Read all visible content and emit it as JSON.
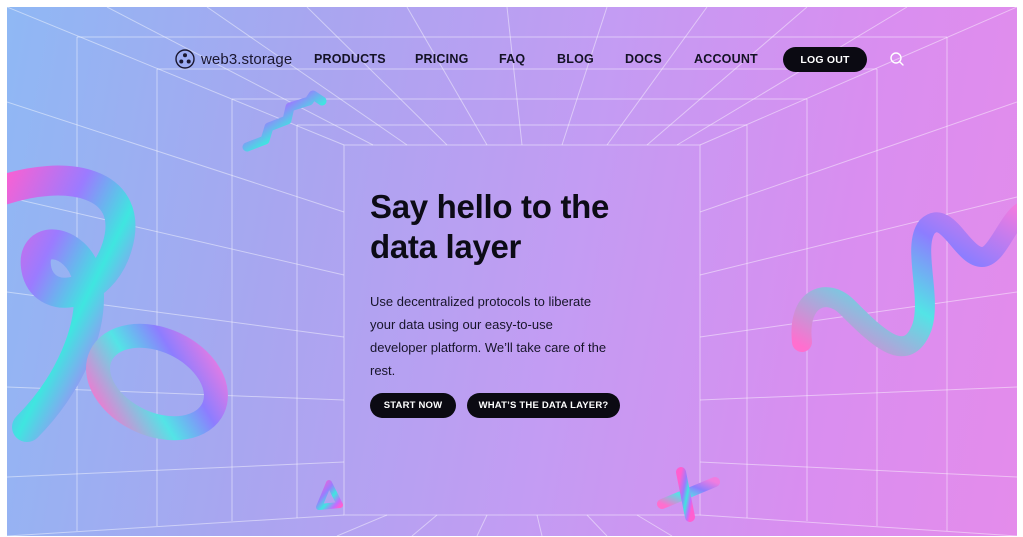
{
  "brand": {
    "name": "web3.storage",
    "logo_icon": "web3-storage-logo-icon"
  },
  "nav": {
    "products": "PRODUCTS",
    "pricing": "PRICING",
    "faq": "FAQ",
    "blog": "BLOG",
    "docs": "DOCS",
    "account": "ACCOUNT",
    "logout": "LOG OUT",
    "search_icon": "search-icon"
  },
  "hero": {
    "title_line1": "Say hello to the",
    "title_line2": "data layer",
    "desc_line1": "Use decentralized protocols to liberate",
    "desc_line2": "your data using our easy-to-use",
    "desc_line3": "developer platform. We’ll take care of the",
    "desc_line4": "rest.",
    "cta_primary": "START NOW",
    "cta_secondary": "WHAT’S THE DATA LAYER?"
  },
  "colors": {
    "background_start": "#8fb8f4",
    "background_end": "#e48ceb",
    "button": "#0b0a12",
    "text": "#0c0b16"
  }
}
